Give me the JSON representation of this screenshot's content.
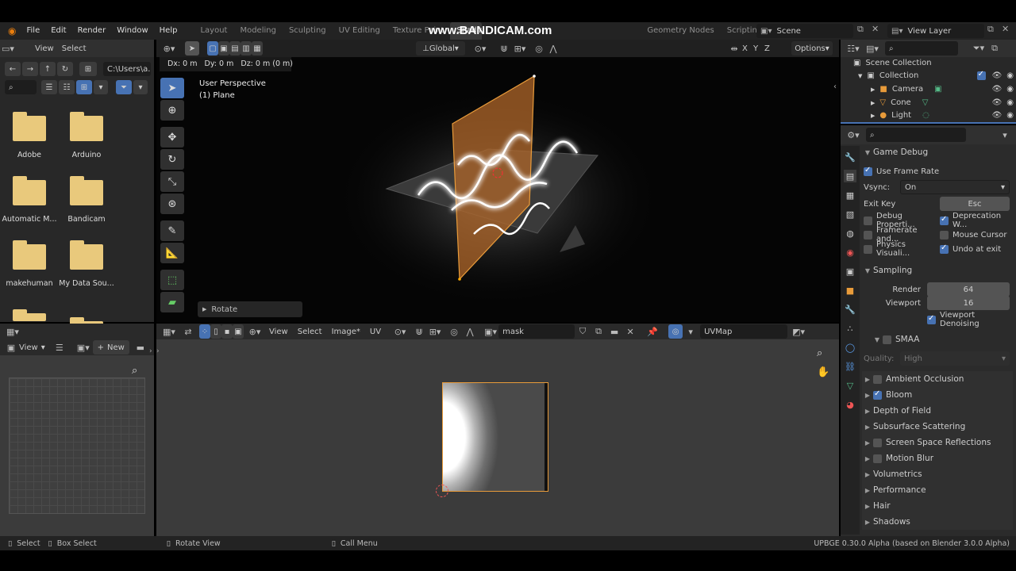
{
  "watermark": "www.BANDICAM.com",
  "menu": {
    "file": "File",
    "edit": "Edit",
    "render": "Render",
    "window": "Window",
    "help": "Help"
  },
  "workspaces": [
    "Layout",
    "Modeling",
    "Sculpting",
    "UV Editing",
    "Texture Paint",
    "Shading",
    "",
    "Geometry Nodes",
    "Scripting"
  ],
  "scene_field": "Scene",
  "view_layer_field": "View Layer",
  "filebrowser": {
    "view": "View",
    "select": "Select",
    "path": "C:\\Users\\a...",
    "folders": [
      {
        "name": "Adobe"
      },
      {
        "name": "Arduino"
      },
      {
        "name": "Automatic M..."
      },
      {
        "name": "Bandicam"
      },
      {
        "name": "makehuman"
      },
      {
        "name": "My Data Sou..."
      },
      {
        "name": ""
      },
      {
        "name": ""
      }
    ]
  },
  "viewport": {
    "transform": "Global",
    "options": "Options",
    "status": "Dx: 0 m   Dy: 0 m   Dz: 0 m (0 m)",
    "perspective": "User Perspective",
    "object": "(1) Plane",
    "last_op": "Rotate",
    "axes": [
      "X",
      "Y",
      "Z"
    ]
  },
  "image_editor": {
    "view": "View",
    "select": "Select",
    "image": "Image*",
    "uv": "UV",
    "image_name": "mask",
    "uvmap": "UVMap"
  },
  "small_editor": {
    "view": "View",
    "new": "New"
  },
  "outliner": {
    "scene_collection": "Scene Collection",
    "items": [
      {
        "name": "Collection"
      },
      {
        "name": "Camera"
      },
      {
        "name": "Cone"
      },
      {
        "name": "Light"
      }
    ]
  },
  "properties": {
    "game_debug": "Game Debug",
    "use_frame_rate": "Use Frame Rate",
    "vsync_label": "Vsync:",
    "vsync_value": "On",
    "exit_key_label": "Exit Key",
    "exit_key_value": "Esc",
    "checks": [
      {
        "label": "Debug Properti...",
        "on": false
      },
      {
        "label": "Deprecation W...",
        "on": true
      },
      {
        "label": "Framerate and...",
        "on": false
      },
      {
        "label": "Mouse Cursor",
        "on": false
      },
      {
        "label": "Physics Visuali...",
        "on": false
      },
      {
        "label": "Undo at exit",
        "on": true
      }
    ],
    "sampling": "Sampling",
    "render_label": "Render",
    "render_value": "64",
    "viewport_label": "Viewport",
    "viewport_value": "16",
    "viewport_denoising": "Viewport Denoising",
    "smaa": "SMAA",
    "quality_label": "Quality:",
    "quality_value": "High",
    "panels": [
      {
        "label": "Ambient Occlusion",
        "checkbox": true,
        "on": false
      },
      {
        "label": "Bloom",
        "checkbox": true,
        "on": true
      },
      {
        "label": "Depth of Field",
        "checkbox": false
      },
      {
        "label": "Subsurface Scattering",
        "checkbox": false
      },
      {
        "label": "Screen Space Reflections",
        "checkbox": true,
        "on": false
      },
      {
        "label": "Motion Blur",
        "checkbox": true,
        "on": false
      },
      {
        "label": "Volumetrics",
        "checkbox": false
      },
      {
        "label": "Performance",
        "checkbox": false
      },
      {
        "label": "Hair",
        "checkbox": false
      },
      {
        "label": "Shadows",
        "checkbox": false
      }
    ]
  },
  "statusbar": {
    "select": "Select",
    "box_select": "Box Select",
    "rotate_view": "Rotate View",
    "call_menu": "Call Menu",
    "version": "UPBGE 0.30.0 Alpha (based on Blender 3.0.0 Alpha)"
  },
  "colors": {
    "accent": "#4772b3",
    "header": "#303030",
    "panel": "#2b2b2b",
    "selection": "#e89b3a"
  }
}
